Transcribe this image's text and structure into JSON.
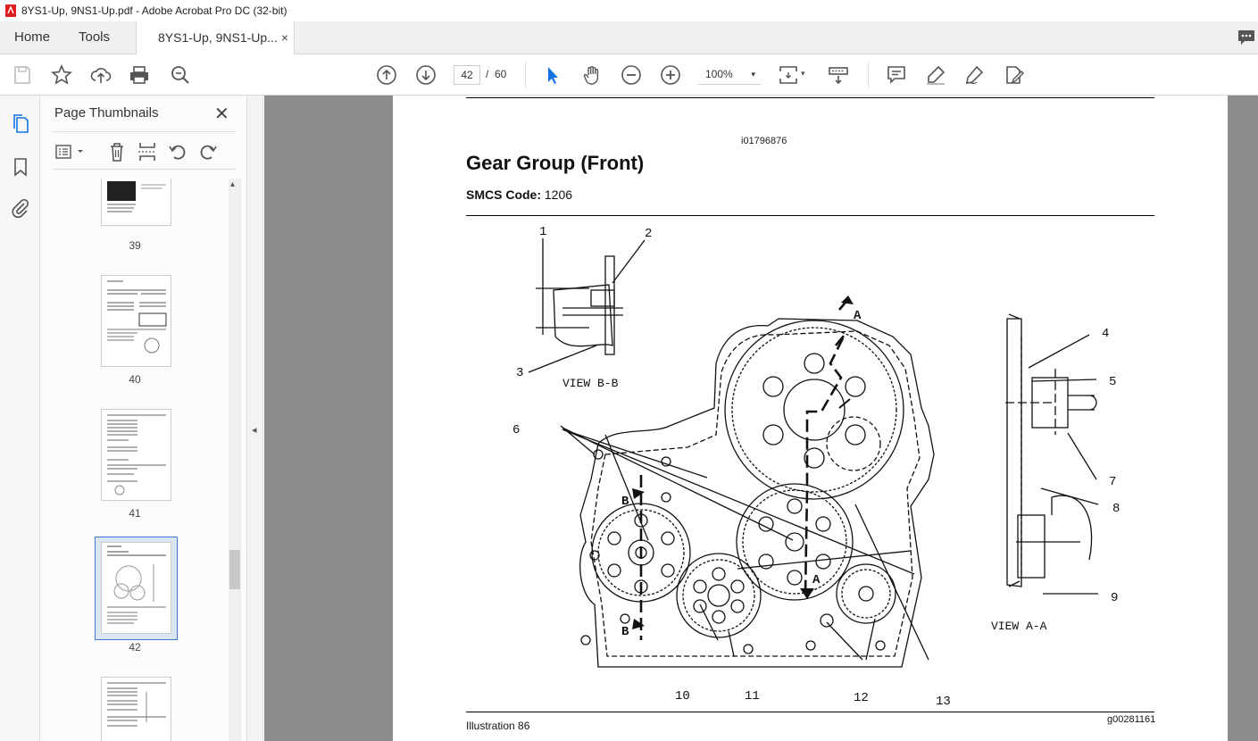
{
  "window": {
    "title": "8YS1-Up, 9NS1-Up.pdf - Adobe Acrobat Pro DC (32-bit)"
  },
  "tabs": {
    "home": "Home",
    "tools": "Tools",
    "document": "8YS1-Up, 9NS1-Up...",
    "close": "×"
  },
  "toolbar": {
    "current_page": "42",
    "separator": "/",
    "total_pages": "60",
    "zoom": "100%",
    "zoom_caret": "▾"
  },
  "panel": {
    "title": "Page Thumbnails",
    "close": "✕",
    "thumbnails": [
      {
        "label": "39"
      },
      {
        "label": "40"
      },
      {
        "label": "41"
      },
      {
        "label": "42"
      },
      {
        "label": ""
      }
    ],
    "collapse_arrow": "◂"
  },
  "document": {
    "doc_id": "i01796876",
    "title": "Gear Group (Front)",
    "smcs_label": "SMCS Code:",
    "smcs_value": "1206",
    "caption": "Illustration 86",
    "graphic_id": "g00281161"
  },
  "diagram": {
    "callouts": [
      "1",
      "2",
      "3",
      "4",
      "5",
      "6",
      "7",
      "8",
      "9",
      "10",
      "11",
      "12",
      "13"
    ],
    "view_bb": "VIEW B-B",
    "view_aa": "VIEW A-A",
    "section_a": "A",
    "section_b": "B"
  },
  "colors": {
    "accent": "#1473e6",
    "chrome": "#f0f0f0",
    "viewer_bg": "#8c8c8c"
  }
}
